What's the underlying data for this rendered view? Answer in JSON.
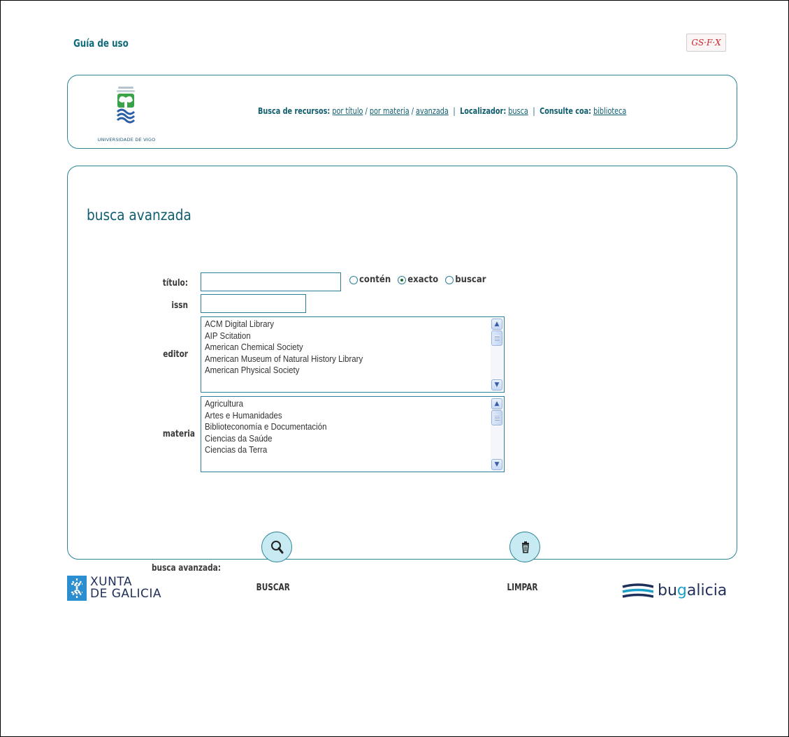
{
  "top": {
    "guide_link": "Guía de uso",
    "sfx_badge": "S·F·X",
    "sfx_mark": "G"
  },
  "header": {
    "logo_caption": "UNIVERSIDADE DE VIGO",
    "resources_label": "Busca de recursos:",
    "links": {
      "by_title": "por título",
      "by_subject": "por materia",
      "advanced": "avanzada",
      "locator_search": "busca",
      "library": "biblioteca"
    },
    "slash1": "/",
    "slash2": "/",
    "pipe1": "|",
    "pipe2": "|",
    "locator_label": "Localizador:",
    "consult_label": "Consulte coa:"
  },
  "form": {
    "title": "busca avanzada",
    "title_label": "título:",
    "title_value": "",
    "issn_label": "issn",
    "issn_value": "",
    "radios": {
      "contains": "contén",
      "exact": "exacto",
      "search": "buscar",
      "selected": "exacto"
    },
    "editor_label": "editor",
    "editor_options": [
      "ACM Digital Library",
      "AIP Scitation",
      "American Chemical Society",
      "American Museum of Natural History Library",
      "American Physical Society"
    ],
    "materia_label": "materia",
    "materia_options": [
      "Agricultura",
      "Artes e Humanidades",
      "Biblioteconomía e Documentación",
      "Ciencias da Saúde",
      "Ciencias da Terra"
    ],
    "search_button": "BUSCAR",
    "clear_button": "LIMPAR",
    "status_label": "busca avanzada:"
  },
  "footer": {
    "xunta_line1": "XUNTA",
    "xunta_line2": "DE GALICIA",
    "bugalicia_prefix": "bu",
    "bugalicia_g": "g",
    "bugalicia_suffix": "alicia"
  },
  "colors": {
    "accent": "#0f5e6e",
    "panel_border": "#2a8595",
    "button_fill": "#c8eaf3",
    "sfx_red": "#c8242b"
  },
  "icons": {
    "search": "magnifier-icon",
    "clear": "trash-icon"
  }
}
